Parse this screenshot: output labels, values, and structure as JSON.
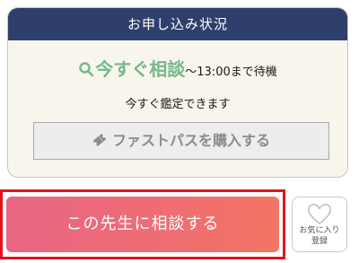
{
  "status": {
    "header": "お申し込み状況",
    "main": "今すぐ相談",
    "wait": "〜13:00まで待機",
    "sub": "今すぐ鑑定できます",
    "fastpass_label": "ファストパスを購入する"
  },
  "actions": {
    "consult_label": "この先生に相談する",
    "favorite_line1": "お気に入り",
    "favorite_line2": "登録"
  },
  "colors": {
    "header_bg": "#2f3f6c",
    "status_green": "#74b88b",
    "consult_gradient_start": "#e86683",
    "consult_gradient_end": "#f27563",
    "highlight_border": "#e2141d"
  },
  "icons": {
    "status_icon": "search-icon",
    "fastpass_icon": "ticket-icon",
    "favorite_icon": "heart-icon"
  }
}
